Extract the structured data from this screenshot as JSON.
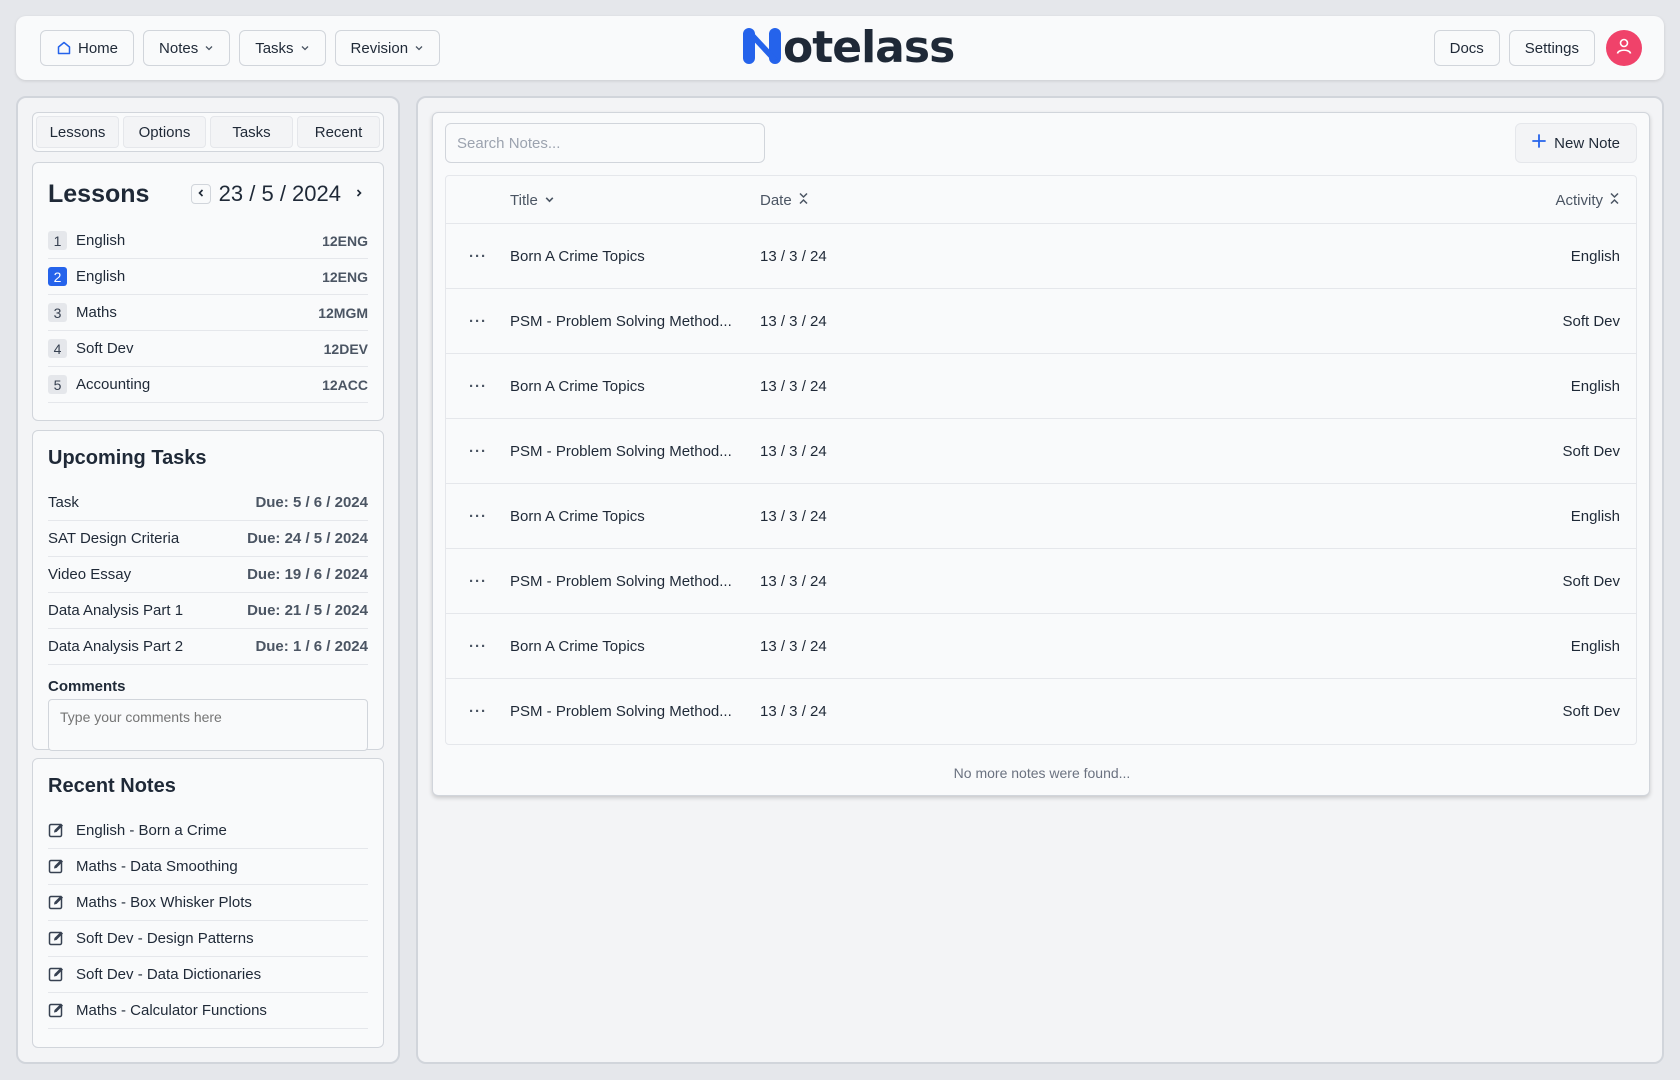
{
  "topbar": {
    "home_label": "Home",
    "notes_label": "Notes",
    "tasks_label": "Tasks",
    "revision_label": "Revision",
    "logo_text": "otelass",
    "logo_mark": "N",
    "docs_label": "Docs",
    "settings_label": "Settings"
  },
  "sidebar": {
    "tabs": [
      "Lessons",
      "Options",
      "Tasks",
      "Recent"
    ],
    "lessons": {
      "title": "Lessons",
      "date": "23 / 5 / 2024",
      "items": [
        {
          "num": "1",
          "name": "English",
          "code": "12ENG"
        },
        {
          "num": "2",
          "name": "English",
          "code": "12ENG"
        },
        {
          "num": "3",
          "name": "Maths",
          "code": "12MGM"
        },
        {
          "num": "4",
          "name": "Soft Dev",
          "code": "12DEV"
        },
        {
          "num": "5",
          "name": "Accounting",
          "code": "12ACC"
        }
      ]
    },
    "tasks": {
      "title": "Upcoming Tasks",
      "items": [
        {
          "name": "Task",
          "due": "Due:  5 / 6 / 2024"
        },
        {
          "name": "SAT Design Criteria",
          "due": "Due:  24 / 5 / 2024"
        },
        {
          "name": "Video Essay",
          "due": "Due:  19 / 6 / 2024"
        },
        {
          "name": "Data Analysis Part 1",
          "due": "Due:  21 / 5 / 2024"
        },
        {
          "name": "Data Analysis Part 2",
          "due": "Due:  1 / 6 / 2024"
        }
      ],
      "comments_label": "Comments",
      "comments_placeholder": "Type your comments here"
    },
    "recent": {
      "title": "Recent Notes",
      "items": [
        "English - Born a Crime",
        "Maths - Data Smoothing",
        "Maths - Box Whisker Plots",
        "Soft Dev - Design Patterns",
        "Soft Dev - Data Dictionaries",
        "Maths - Calculator Functions"
      ]
    }
  },
  "main": {
    "search_placeholder": "Search Notes...",
    "new_note_label": "New Note",
    "columns": {
      "title": "Title",
      "date": "Date",
      "activity": "Activity"
    },
    "rows": [
      {
        "title": "Born A Crime Topics",
        "date": "13 / 3 / 24",
        "activity": "English"
      },
      {
        "title": "PSM - Problem Solving Method...",
        "date": "13 / 3 / 24",
        "activity": "Soft Dev"
      },
      {
        "title": "Born A Crime Topics",
        "date": "13 / 3 / 24",
        "activity": "English"
      },
      {
        "title": "PSM - Problem Solving Method...",
        "date": "13 / 3 / 24",
        "activity": "Soft Dev"
      },
      {
        "title": "Born A Crime Topics",
        "date": "13 / 3 / 24",
        "activity": "English"
      },
      {
        "title": "PSM - Problem Solving Method...",
        "date": "13 / 3 / 24",
        "activity": "Soft Dev"
      },
      {
        "title": "Born A Crime Topics",
        "date": "13 / 3 / 24",
        "activity": "English"
      },
      {
        "title": "PSM - Problem Solving Method...",
        "date": "13 / 3 / 24",
        "activity": "Soft Dev"
      }
    ],
    "row_menu_glyph": "···",
    "footer": "No more notes were found..."
  },
  "colors": {
    "accent": "#2563eb",
    "avatar": "#f0426a",
    "logo_mark": "#2563eb"
  },
  "icons": {
    "home": "home-icon",
    "chevron": "chevron-down-icon",
    "user": "user-icon",
    "plus": "plus-icon",
    "edit": "edit-note-icon",
    "sort": "sort-icon"
  }
}
